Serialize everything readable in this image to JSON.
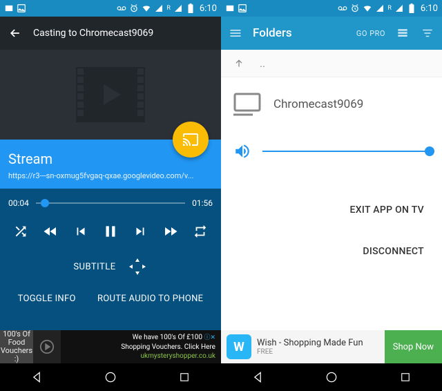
{
  "status": {
    "time": "6:10"
  },
  "left": {
    "header_title": "Casting to Chromecast9069",
    "stream_title": "Stream",
    "stream_url": "https://r3---sn-oxmug5fvgaq-qxae.googlevideo.com/v...",
    "time_current": "00:04",
    "time_total": "01:56",
    "subtitle_label": "SUBTITLE",
    "toggle_info": "TOGGLE INFO",
    "route_audio": "ROUTE AUDIO TO PHONE",
    "ad": {
      "thumb_text": "100's Of Food Vouchers :)",
      "line1": "We have 100's Of £100",
      "line2": "Shopping Vouchers. Click Here",
      "link": "ukmysteryshopper.co.uk"
    }
  },
  "right": {
    "toolbar_title": "Folders",
    "go_pro": "GO PRO",
    "up_label": "..",
    "device_name": "Chromecast9069",
    "exit_label": "EXIT APP ON TV",
    "disconnect_label": "DISCONNECT",
    "ad": {
      "title": "Wish - Shopping Made Fun",
      "sub": "FREE",
      "cta": "Shop Now"
    }
  }
}
